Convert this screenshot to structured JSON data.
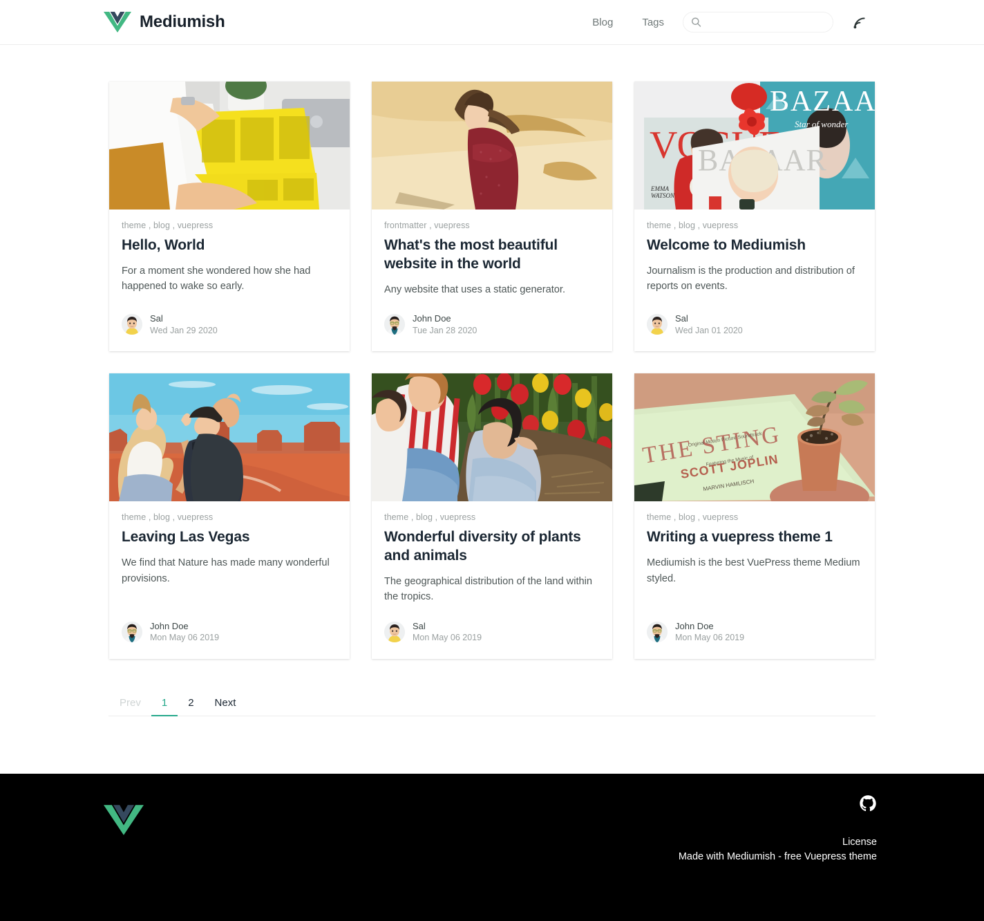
{
  "header": {
    "brand_name": "Mediumish",
    "logo_icon": "vue-logo-icon",
    "nav": [
      {
        "label": "Blog",
        "name": "nav-link-blog"
      },
      {
        "label": "Tags",
        "name": "nav-link-tags"
      }
    ],
    "search": {
      "value": "",
      "placeholder": "",
      "icon": "search-icon"
    },
    "rss": {
      "icon": "rss-icon",
      "label": "RSS"
    }
  },
  "colors": {
    "accent_green": "#26a98b",
    "vue_green": "#42b883",
    "vue_dark": "#35495e",
    "title_text": "#1b2733",
    "muted_text": "#9aa0a0",
    "body_text": "#4d5656",
    "footer_bg": "#000000",
    "header_border": "#ececec"
  },
  "posts": [
    {
      "tags": "theme , blog , vuepress",
      "title": "Hello, World",
      "excerpt": "For a moment she wondered how she had happened to wake so early.",
      "author": "Sal",
      "date": "Wed Jan 29 2020",
      "avatar_icon": "avatar-sal",
      "image_name": "hands-holding-yellow-magazine-on-desk"
    },
    {
      "tags": "frontmatter , vuepress",
      "title": "What's the most beautiful website in the world",
      "excerpt": "Any website that uses a static generator.",
      "author": "John Doe",
      "date": "Tue Jan 28 2020",
      "avatar_icon": "avatar-john-doe",
      "image_name": "girl-in-red-dress-against-sand-wall"
    },
    {
      "tags": "theme , blog , vuepress",
      "title": "Welcome to Mediumish",
      "excerpt": "Journalism is the production and distribution of reports on events.",
      "author": "Sal",
      "date": "Wed Jan 01 2020",
      "avatar_icon": "avatar-sal",
      "image_name": "fashion-magazines-vogue-bazaar-with-red-bow"
    },
    {
      "tags": "theme , blog , vuepress",
      "title": "Leaving Las Vegas",
      "excerpt": "We find that Nature has made many wonderful provisions.",
      "author": "John Doe",
      "date": "Mon May 06 2019",
      "avatar_icon": "avatar-john-doe",
      "image_name": "two-women-at-monument-valley-desert"
    },
    {
      "tags": "theme , blog , vuepress",
      "title": "Wonderful diversity of plants and animals",
      "excerpt": "The geographical distribution of the land within the tropics.",
      "author": "Sal",
      "date": "Mon May 06 2019",
      "avatar_icon": "avatar-sal",
      "image_name": "women-sitting-in-tulip-garden"
    },
    {
      "tags": "theme , blog , vuepress",
      "title": "Writing a vuepress theme 1",
      "excerpt": "Mediumish is the best VuePress theme Medium styled.",
      "author": "John Doe",
      "date": "Mon May 06 2019",
      "avatar_icon": "avatar-john-doe",
      "image_name": "the-sting-scott-joplin-record-with-potted-plant"
    }
  ],
  "pagination": {
    "prev": "Prev",
    "pages": [
      "1",
      "2"
    ],
    "next": "Next",
    "active_page": "1"
  },
  "footer": {
    "logo_icon": "vue-logo-icon",
    "github_icon": "github-icon",
    "license_label": "License",
    "credit": "Made with Mediumish - free Vuepress theme"
  }
}
